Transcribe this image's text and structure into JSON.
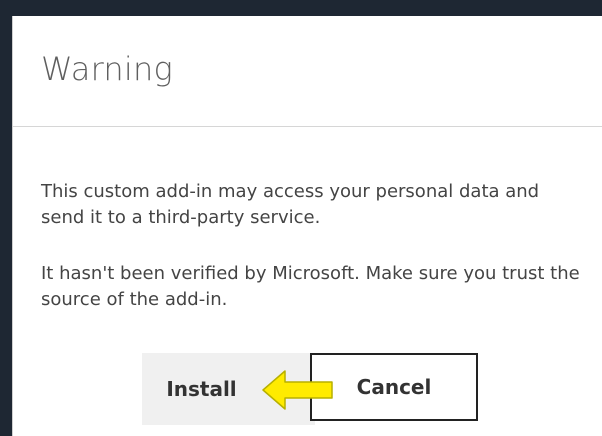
{
  "dialog": {
    "title": "Warning",
    "message_1": "This custom add-in may access your personal data and send it to a third-party service.",
    "message_2": "It hasn't been verified by Microsoft. Make sure you trust the source of the add-in."
  },
  "buttons": {
    "install_label": "Install",
    "cancel_label": "Cancel"
  },
  "colors": {
    "background": "#1e2733",
    "dialog": "#ffffff",
    "title": "#5f5f5f",
    "text": "#444444",
    "install_button": "#f0f0f0",
    "cancel_border": "#222222",
    "arrow": "#ffeb00"
  },
  "icons": {
    "annotation_arrow": "left-arrow-icon"
  }
}
